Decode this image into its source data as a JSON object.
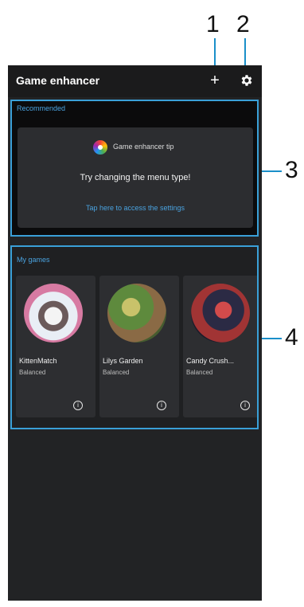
{
  "callouts": [
    "1",
    "2",
    "3",
    "4"
  ],
  "header": {
    "title": "Game enhancer",
    "add_icon": "plus-icon",
    "settings_icon": "gear-icon"
  },
  "recommended": {
    "label": "Recommended",
    "tip_title": "Game enhancer tip",
    "tip_text": "Try changing the menu type!",
    "tip_link": "Tap here to access the settings"
  },
  "my_games": {
    "label": "My games",
    "games": [
      {
        "name": "KittenMatch",
        "mode": "Balanced"
      },
      {
        "name": "Lilys Garden",
        "mode": "Balanced"
      },
      {
        "name": "Candy Crush...",
        "mode": "Balanced"
      }
    ]
  },
  "colors": {
    "accent": "#3aa0d8",
    "link": "#4aa3e0",
    "background": "#222325"
  }
}
